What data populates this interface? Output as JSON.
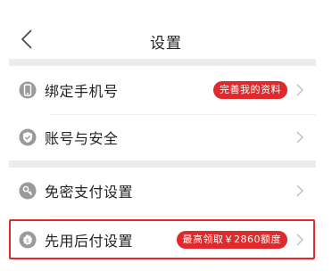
{
  "header": {
    "title": "设置"
  },
  "sections": [
    {
      "items": [
        {
          "label": "绑定手机号",
          "badge": "完善我的资料",
          "icon": "phone-icon"
        },
        {
          "label": "账号与安全",
          "badge": "",
          "icon": "shield-check-icon"
        }
      ]
    },
    {
      "items": [
        {
          "label": "免密支付设置",
          "badge": "",
          "icon": "key-icon"
        },
        {
          "label": "先用后付设置",
          "badge": "最高领取￥2860额度",
          "icon": "gear-badge-icon"
        }
      ]
    }
  ],
  "colors": {
    "accent": "#e0292b",
    "icon": "#9a9a9a",
    "separator": "#ececec"
  }
}
